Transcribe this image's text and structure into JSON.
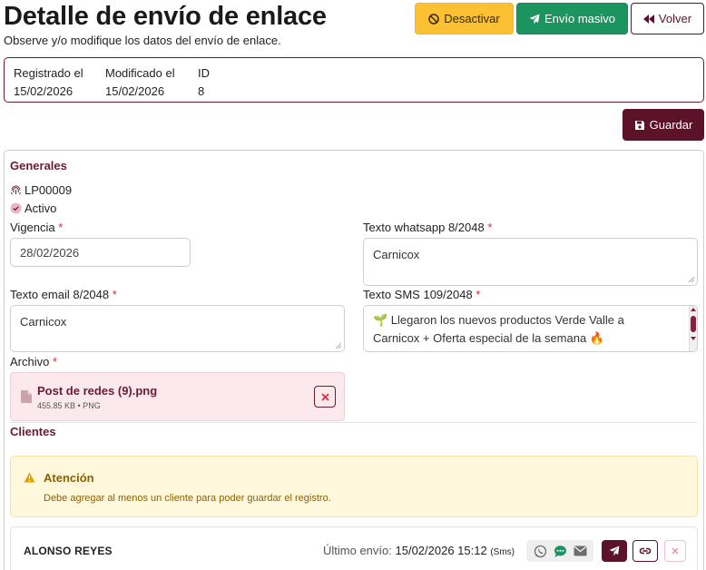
{
  "header": {
    "title": "Detalle de envío de enlace",
    "subtitle": "Observe y/o modifique los datos del envío de enlace.",
    "buttons": {
      "deactivate": "Desactivar",
      "bulk_send": "Envío masivo",
      "back": "Volver"
    }
  },
  "meta": {
    "registered_label": "Registrado el",
    "registered_value": "15/02/2026",
    "modified_label": "Modificado el",
    "modified_value": "15/02/2026",
    "id_label": "ID",
    "id_value": "8"
  },
  "save_label": "Guardar",
  "general": {
    "section_title": "Generales",
    "code": "LP00009",
    "status": "Activo",
    "validity_label": "Vigencia",
    "validity_value": "28/02/2026",
    "whatsapp_label": "Texto whatsapp 8/2048",
    "whatsapp_value": "Carnicox",
    "email_label": "Texto email 8/2048",
    "email_value": "Carnicox",
    "sms_label": "Texto SMS 109/2048",
    "sms_line1": "🌱 Llegaron los nuevos productos Verde Valle a",
    "sms_line2": "Carnicox + Oferta especial de la semana 🔥",
    "required_mark": "*",
    "file_label": "Archivo",
    "file_name": "Post de redes (9).png",
    "file_meta": "455.85 KB • PNG"
  },
  "clients": {
    "section_title": "Clientes",
    "alert_title": "Atención",
    "alert_text": "Debe agregar al menos un cliente para poder guardar el registro.",
    "rows": [
      {
        "name": "ALONSO REYES",
        "last_send_label": "Último envío:",
        "last_send_date": "15/02/2026 15:12",
        "last_send_channel": "(Sms)"
      }
    ]
  },
  "colors": {
    "brand": "#5c1329",
    "warning": "#fcc133",
    "success": "#1c9460",
    "alert_bg": "#fff8dd",
    "file_bg": "#fbe9ed"
  },
  "icons": [
    "ban-icon",
    "paper-plane-icon",
    "backward-icon",
    "save-icon",
    "fingerprint-icon",
    "check-circle-icon",
    "file-icon",
    "close-icon",
    "warning-icon",
    "whatsapp-icon",
    "sms-icon",
    "envelope-icon",
    "link-icon"
  ]
}
